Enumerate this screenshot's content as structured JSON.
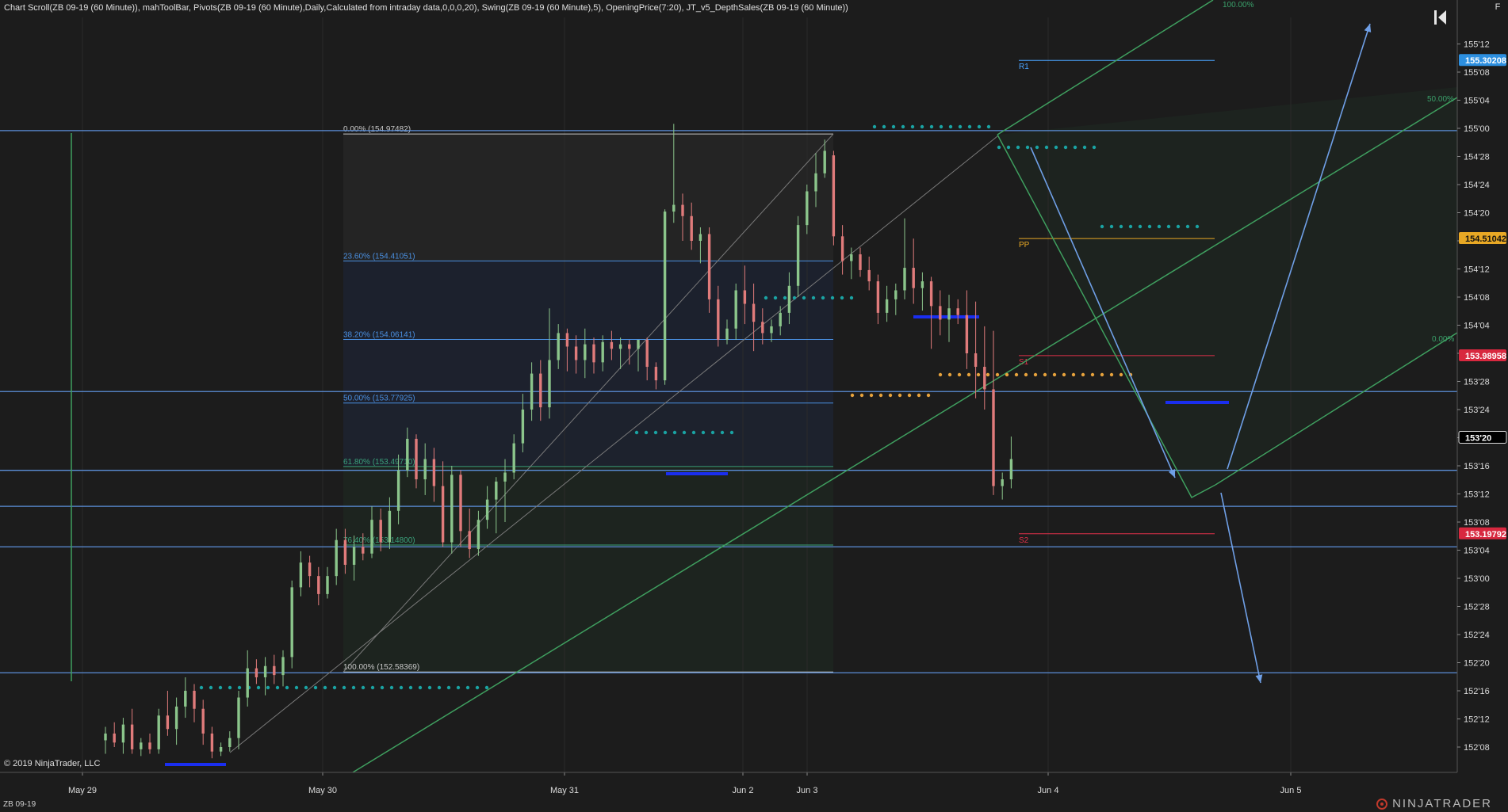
{
  "header": {
    "indicators": "Chart Scroll(ZB 09-19 (60 Minute)), mahToolBar, Pivots(ZB 09-19 (60 Minute),Daily,Calculated from intraday data,0,0,0,20), Swing(ZB 09-19 (60 Minute),5), OpeningPrice(7:20), JT_v5_DepthSales(ZB 09-19 (60 Minute))"
  },
  "footer": {
    "copyright": "© 2019 NinjaTrader, LLC",
    "instrument": "ZB 09-19",
    "brand": "NINJATRADER",
    "f_button": "F"
  },
  "colors": {
    "background": "#1c1c1c",
    "up_candle": "#8bc58b",
    "down_candle": "#e07b7b",
    "hline": "#5b8fd9",
    "channel": "#3f9f5f",
    "fib_grey": "#c8c8c8",
    "teal_dots": "#1aa3a3",
    "orange_dots": "#e6a23c",
    "blue_bar": "#1a2ef0",
    "r1": "#4aa3ff",
    "pp": "#e8a825",
    "s": "#e0304a",
    "arrow": "#6f9fe6"
  },
  "chart_data": {
    "type": "candlestick",
    "price_axis_ticks": [
      "155'12",
      "155'08",
      "155'04",
      "155'00",
      "154'28",
      "154'24",
      "154'20",
      "154'16",
      "154'12",
      "154'08",
      "154'04",
      "154'00",
      "153'28",
      "153'24",
      "153'20",
      "153'16",
      "153'12",
      "153'08",
      "153'04",
      "153'00",
      "152'28",
      "152'24",
      "152'20",
      "152'16",
      "152'12",
      "152'08"
    ],
    "price_axis_values": [
      155.375,
      155.25,
      155.125,
      155.0,
      154.875,
      154.75,
      154.625,
      154.5,
      154.375,
      154.25,
      154.125,
      154.0,
      153.875,
      153.75,
      153.625,
      153.5,
      153.375,
      153.25,
      153.125,
      153.0,
      152.875,
      152.75,
      152.625,
      152.5,
      152.375,
      152.25
    ],
    "ylim": [
      152.21,
      155.55
    ],
    "time_axis_labels": [
      "May 29",
      "May 30",
      "May 31",
      "Jun 2",
      "Jun 3",
      "Jun 4",
      "Jun 5"
    ],
    "price_markers": [
      {
        "label": "155.30208",
        "value": 155.30208,
        "color": "#2c8fe0"
      },
      {
        "label": "154.51042",
        "value": 154.51042,
        "color": "#e8a825"
      },
      {
        "label": "153.98958",
        "value": 153.98958,
        "color": "#d8283f"
      },
      {
        "label": "153'20",
        "value": 153.625,
        "color": "#000000"
      },
      {
        "label": "153.19792",
        "value": 153.19792,
        "color": "#d8283f"
      }
    ],
    "fib_levels": [
      {
        "label": "0.00% (154.97482)",
        "value": 154.97482
      },
      {
        "label": "23.60% (154.41051)",
        "value": 154.41051
      },
      {
        "label": "38.20% (154.06141)",
        "value": 154.06141
      },
      {
        "label": "50.00% (153.77925)",
        "value": 153.77925
      },
      {
        "label": "61.80% (153.49710)",
        "value": 153.4971
      },
      {
        "label": "76.40% (153.14800)",
        "value": 153.148
      },
      {
        "label": "100.00% (152.58369)",
        "value": 152.58369
      }
    ],
    "pivots": [
      {
        "label": "R1",
        "value": 155.302
      },
      {
        "label": "PP",
        "value": 154.51
      },
      {
        "label": "S1",
        "value": 153.99
      },
      {
        "label": "S2",
        "value": 153.198
      }
    ],
    "horizontal_lines": [
      154.99,
      153.83,
      153.48,
      153.32,
      153.14,
      152.58
    ],
    "channel_labels": [
      "100.00%",
      "50.00%",
      "0.00%"
    ],
    "candles": [
      {
        "o": 152.28,
        "h": 152.34,
        "l": 152.22,
        "c": 152.31
      },
      {
        "o": 152.31,
        "h": 152.36,
        "l": 152.25,
        "c": 152.27
      },
      {
        "o": 152.27,
        "h": 152.38,
        "l": 152.22,
        "c": 152.35
      },
      {
        "o": 152.35,
        "h": 152.42,
        "l": 152.22,
        "c": 152.24
      },
      {
        "o": 152.24,
        "h": 152.29,
        "l": 152.21,
        "c": 152.27
      },
      {
        "o": 152.27,
        "h": 152.31,
        "l": 152.22,
        "c": 152.24
      },
      {
        "o": 152.24,
        "h": 152.42,
        "l": 152.22,
        "c": 152.39
      },
      {
        "o": 152.39,
        "h": 152.5,
        "l": 152.3,
        "c": 152.33
      },
      {
        "o": 152.33,
        "h": 152.47,
        "l": 152.26,
        "c": 152.43
      },
      {
        "o": 152.43,
        "h": 152.56,
        "l": 152.38,
        "c": 152.5
      },
      {
        "o": 152.5,
        "h": 152.53,
        "l": 152.36,
        "c": 152.42
      },
      {
        "o": 152.42,
        "h": 152.46,
        "l": 152.26,
        "c": 152.31
      },
      {
        "o": 152.31,
        "h": 152.34,
        "l": 152.2,
        "c": 152.23
      },
      {
        "o": 152.23,
        "h": 152.27,
        "l": 152.21,
        "c": 152.25
      },
      {
        "o": 152.25,
        "h": 152.32,
        "l": 152.23,
        "c": 152.29
      },
      {
        "o": 152.29,
        "h": 152.5,
        "l": 152.24,
        "c": 152.47
      },
      {
        "o": 152.47,
        "h": 152.68,
        "l": 152.43,
        "c": 152.6
      },
      {
        "o": 152.6,
        "h": 152.64,
        "l": 152.53,
        "c": 152.56
      },
      {
        "o": 152.56,
        "h": 152.65,
        "l": 152.48,
        "c": 152.61
      },
      {
        "o": 152.61,
        "h": 152.66,
        "l": 152.53,
        "c": 152.57
      },
      {
        "o": 152.57,
        "h": 152.68,
        "l": 152.52,
        "c": 152.65
      },
      {
        "o": 152.65,
        "h": 152.99,
        "l": 152.6,
        "c": 152.96
      },
      {
        "o": 152.96,
        "h": 153.12,
        "l": 152.92,
        "c": 153.07
      },
      {
        "o": 153.07,
        "h": 153.1,
        "l": 152.96,
        "c": 153.01
      },
      {
        "o": 153.01,
        "h": 153.05,
        "l": 152.88,
        "c": 152.93
      },
      {
        "o": 152.93,
        "h": 153.05,
        "l": 152.91,
        "c": 153.01
      },
      {
        "o": 153.01,
        "h": 153.22,
        "l": 152.97,
        "c": 153.17
      },
      {
        "o": 153.17,
        "h": 153.22,
        "l": 153.02,
        "c": 153.06
      },
      {
        "o": 153.06,
        "h": 153.19,
        "l": 152.99,
        "c": 153.14
      },
      {
        "o": 153.14,
        "h": 153.2,
        "l": 153.08,
        "c": 153.11
      },
      {
        "o": 153.11,
        "h": 153.32,
        "l": 153.09,
        "c": 153.26
      },
      {
        "o": 153.26,
        "h": 153.31,
        "l": 153.12,
        "c": 153.16
      },
      {
        "o": 153.16,
        "h": 153.36,
        "l": 153.13,
        "c": 153.3
      },
      {
        "o": 153.3,
        "h": 153.55,
        "l": 153.24,
        "c": 153.48
      },
      {
        "o": 153.48,
        "h": 153.67,
        "l": 153.45,
        "c": 153.62
      },
      {
        "o": 153.62,
        "h": 153.64,
        "l": 153.4,
        "c": 153.44
      },
      {
        "o": 153.44,
        "h": 153.6,
        "l": 153.37,
        "c": 153.53
      },
      {
        "o": 153.53,
        "h": 153.58,
        "l": 153.34,
        "c": 153.41
      },
      {
        "o": 153.41,
        "h": 153.52,
        "l": 153.14,
        "c": 153.16
      },
      {
        "o": 153.16,
        "h": 153.5,
        "l": 153.11,
        "c": 153.46
      },
      {
        "o": 153.46,
        "h": 153.48,
        "l": 153.14,
        "c": 153.21
      },
      {
        "o": 153.21,
        "h": 153.31,
        "l": 153.09,
        "c": 153.13
      },
      {
        "o": 153.13,
        "h": 153.3,
        "l": 153.1,
        "c": 153.26
      },
      {
        "o": 153.26,
        "h": 153.41,
        "l": 153.22,
        "c": 153.35
      },
      {
        "o": 153.35,
        "h": 153.45,
        "l": 153.2,
        "c": 153.43
      },
      {
        "o": 153.43,
        "h": 153.53,
        "l": 153.25,
        "c": 153.47
      },
      {
        "o": 153.47,
        "h": 153.64,
        "l": 153.44,
        "c": 153.6
      },
      {
        "o": 153.6,
        "h": 153.82,
        "l": 153.56,
        "c": 153.75
      },
      {
        "o": 153.75,
        "h": 153.96,
        "l": 153.7,
        "c": 153.91
      },
      {
        "o": 153.91,
        "h": 153.97,
        "l": 153.7,
        "c": 153.76
      },
      {
        "o": 153.76,
        "h": 154.2,
        "l": 153.71,
        "c": 153.97
      },
      {
        "o": 153.97,
        "h": 154.13,
        "l": 153.93,
        "c": 154.09
      },
      {
        "o": 154.09,
        "h": 154.11,
        "l": 153.92,
        "c": 154.03
      },
      {
        "o": 154.03,
        "h": 154.08,
        "l": 153.91,
        "c": 153.97
      },
      {
        "o": 153.97,
        "h": 154.11,
        "l": 153.89,
        "c": 154.04
      },
      {
        "o": 154.04,
        "h": 154.07,
        "l": 153.91,
        "c": 153.96
      },
      {
        "o": 153.96,
        "h": 154.08,
        "l": 153.92,
        "c": 154.05
      },
      {
        "o": 154.05,
        "h": 154.1,
        "l": 153.97,
        "c": 154.02
      },
      {
        "o": 154.02,
        "h": 154.07,
        "l": 153.93,
        "c": 154.04
      },
      {
        "o": 154.04,
        "h": 154.06,
        "l": 153.95,
        "c": 154.02
      },
      {
        "o": 154.02,
        "h": 154.06,
        "l": 153.92,
        "c": 154.06
      },
      {
        "o": 154.06,
        "h": 154.07,
        "l": 153.88,
        "c": 153.94
      },
      {
        "o": 153.94,
        "h": 153.96,
        "l": 153.84,
        "c": 153.88
      },
      {
        "o": 153.88,
        "h": 154.64,
        "l": 153.86,
        "c": 154.63
      },
      {
        "o": 154.63,
        "h": 155.02,
        "l": 154.58,
        "c": 154.66
      },
      {
        "o": 154.66,
        "h": 154.71,
        "l": 154.5,
        "c": 154.61
      },
      {
        "o": 154.61,
        "h": 154.67,
        "l": 154.46,
        "c": 154.5
      },
      {
        "o": 154.5,
        "h": 154.56,
        "l": 154.4,
        "c": 154.53
      },
      {
        "o": 154.53,
        "h": 154.56,
        "l": 154.18,
        "c": 154.24
      },
      {
        "o": 154.24,
        "h": 154.3,
        "l": 154.03,
        "c": 154.06
      },
      {
        "o": 154.06,
        "h": 154.15,
        "l": 154.04,
        "c": 154.11
      },
      {
        "o": 154.11,
        "h": 154.31,
        "l": 154.06,
        "c": 154.28
      },
      {
        "o": 154.28,
        "h": 154.39,
        "l": 154.13,
        "c": 154.22
      },
      {
        "o": 154.22,
        "h": 154.31,
        "l": 154.01,
        "c": 154.14
      },
      {
        "o": 154.14,
        "h": 154.2,
        "l": 154.04,
        "c": 154.09
      },
      {
        "o": 154.09,
        "h": 154.15,
        "l": 154.05,
        "c": 154.12
      },
      {
        "o": 154.12,
        "h": 154.21,
        "l": 154.08,
        "c": 154.18
      },
      {
        "o": 154.18,
        "h": 154.36,
        "l": 154.13,
        "c": 154.3
      },
      {
        "o": 154.3,
        "h": 154.61,
        "l": 154.25,
        "c": 154.57
      },
      {
        "o": 154.57,
        "h": 154.75,
        "l": 154.53,
        "c": 154.72
      },
      {
        "o": 154.72,
        "h": 154.89,
        "l": 154.65,
        "c": 154.8
      },
      {
        "o": 154.8,
        "h": 154.95,
        "l": 154.78,
        "c": 154.9
      },
      {
        "o": 154.88,
        "h": 154.9,
        "l": 154.48,
        "c": 154.52
      },
      {
        "o": 154.52,
        "h": 154.57,
        "l": 154.35,
        "c": 154.41
      },
      {
        "o": 154.41,
        "h": 154.47,
        "l": 154.33,
        "c": 154.44
      },
      {
        "o": 154.44,
        "h": 154.47,
        "l": 154.34,
        "c": 154.37
      },
      {
        "o": 154.37,
        "h": 154.43,
        "l": 154.28,
        "c": 154.32
      },
      {
        "o": 154.32,
        "h": 154.35,
        "l": 154.13,
        "c": 154.18
      },
      {
        "o": 154.18,
        "h": 154.3,
        "l": 154.14,
        "c": 154.24
      },
      {
        "o": 154.24,
        "h": 154.31,
        "l": 154.17,
        "c": 154.28
      },
      {
        "o": 154.28,
        "h": 154.6,
        "l": 154.24,
        "c": 154.38
      },
      {
        "o": 154.38,
        "h": 154.51,
        "l": 154.22,
        "c": 154.29
      },
      {
        "o": 154.29,
        "h": 154.36,
        "l": 154.19,
        "c": 154.32
      },
      {
        "o": 154.32,
        "h": 154.34,
        "l": 154.02,
        "c": 154.21
      },
      {
        "o": 154.21,
        "h": 154.28,
        "l": 154.08,
        "c": 154.15
      },
      {
        "o": 154.15,
        "h": 154.26,
        "l": 154.05,
        "c": 154.2
      },
      {
        "o": 154.2,
        "h": 154.24,
        "l": 154.13,
        "c": 154.17
      },
      {
        "o": 154.17,
        "h": 154.28,
        "l": 153.93,
        "c": 154.0
      },
      {
        "o": 154.0,
        "h": 154.23,
        "l": 153.8,
        "c": 153.94
      },
      {
        "o": 153.94,
        "h": 154.12,
        "l": 153.75,
        "c": 153.84
      },
      {
        "o": 153.84,
        "h": 154.1,
        "l": 153.37,
        "c": 153.41
      },
      {
        "o": 153.41,
        "h": 153.47,
        "l": 153.35,
        "c": 153.44
      },
      {
        "o": 153.44,
        "h": 153.63,
        "l": 153.4,
        "c": 153.53
      }
    ]
  }
}
